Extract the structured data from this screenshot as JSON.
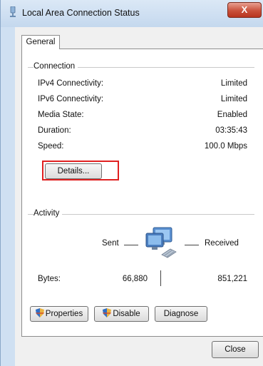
{
  "window": {
    "title": "Local Area Connection Status",
    "close_label": "X"
  },
  "tabs": [
    {
      "label": "General"
    }
  ],
  "connection": {
    "group_label": "Connection",
    "rows": [
      {
        "label": "IPv4 Connectivity:",
        "value": "Limited"
      },
      {
        "label": "IPv6 Connectivity:",
        "value": "Limited"
      },
      {
        "label": "Media State:",
        "value": "Enabled"
      },
      {
        "label": "Duration:",
        "value": "03:35:43"
      },
      {
        "label": "Speed:",
        "value": "100.0 Mbps"
      }
    ],
    "details_button": "Details..."
  },
  "activity": {
    "group_label": "Activity",
    "sent_label": "Sent",
    "received_label": "Received",
    "bytes_label": "Bytes:",
    "bytes_sent": "66,880",
    "bytes_received": "851,221"
  },
  "buttons": {
    "properties": "Properties",
    "disable": "Disable",
    "diagnose": "Diagnose",
    "close": "Close"
  },
  "colors": {
    "highlight": "#e02020",
    "close_button": "#c9513b",
    "window_frame": "#cfe0f2"
  },
  "icons": [
    "network-icon",
    "network-computers-icon",
    "shield-icon"
  ]
}
